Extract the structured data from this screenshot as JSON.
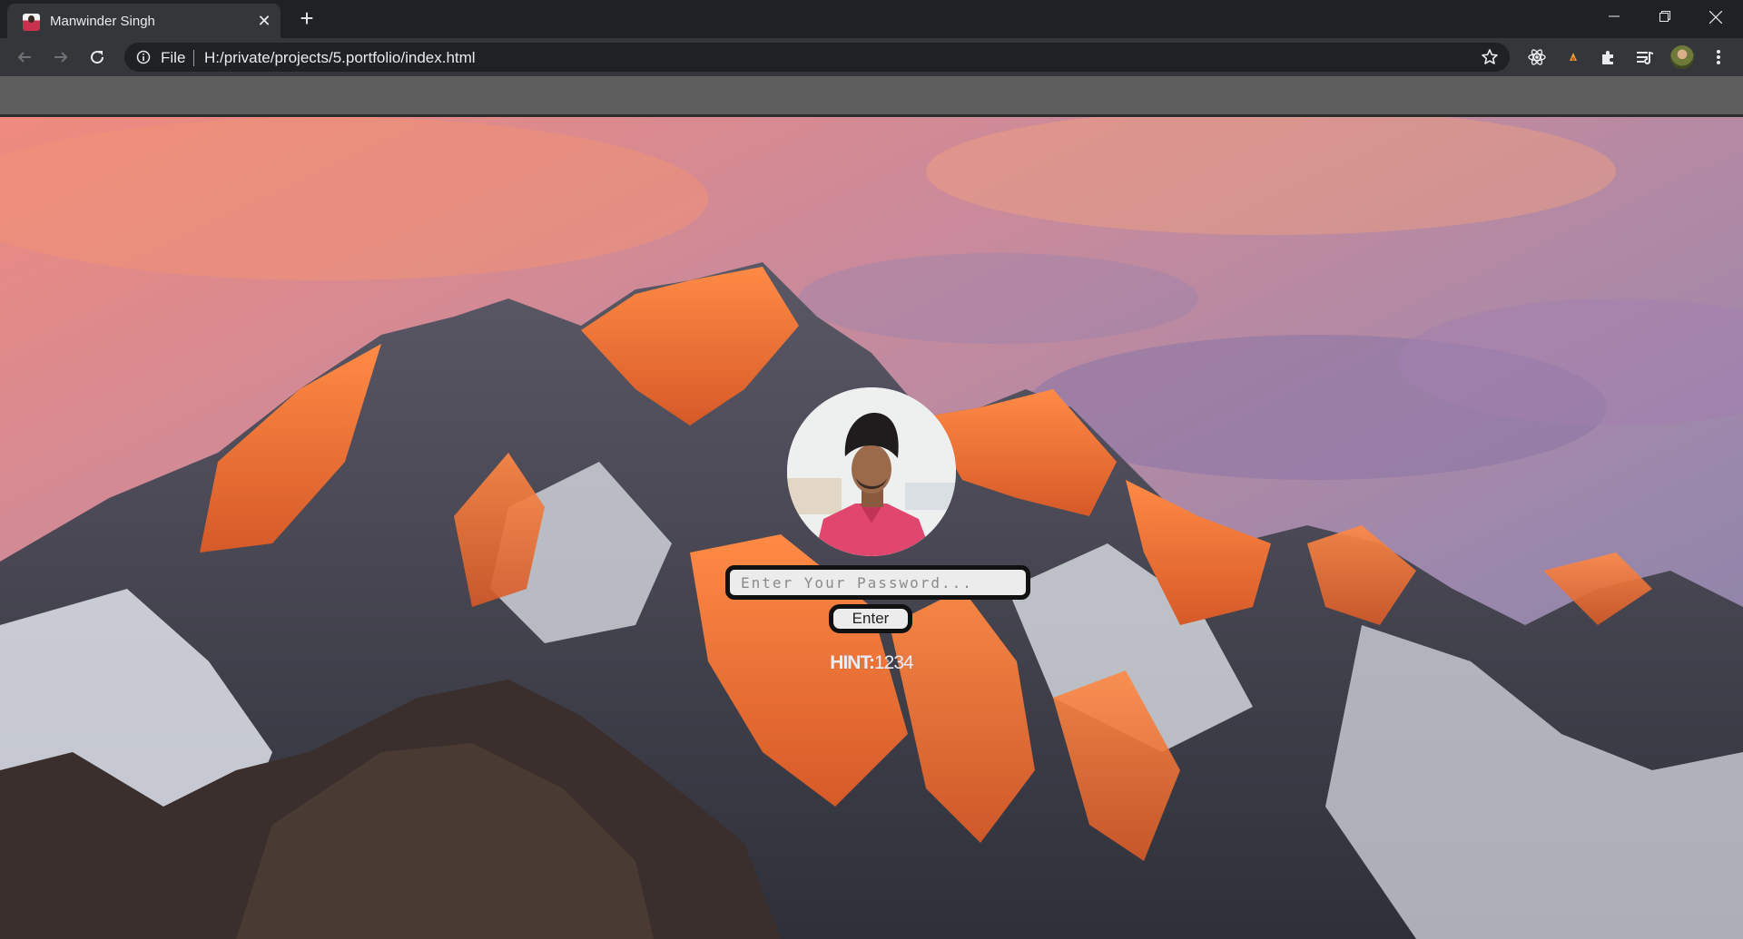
{
  "browser": {
    "tab": {
      "title": "Manwinder Singh",
      "close_icon": "close-icon"
    },
    "new_tab_icon": "plus-icon",
    "window_controls": [
      "minimize-icon",
      "restore-icon",
      "close-icon"
    ],
    "address_bar": {
      "scheme_label": "File",
      "url": "H:/private/projects/5.portfolio/index.html"
    },
    "extensions": [
      "react-devtools-icon",
      "ext-orange-icon",
      "puzzle-icon",
      "media-queue-icon"
    ]
  },
  "page": {
    "password": {
      "placeholder": "Enter Your Password...",
      "value": ""
    },
    "enter_label": "Enter",
    "hint_label": "HINT:",
    "hint_value": "1234"
  },
  "colors": {
    "chrome_dark": "#202124",
    "chrome_toolbar": "#35363a",
    "bookmark_bar": "#5d5d5d",
    "input_border": "#111111",
    "shirt_pink": "#e0466e"
  }
}
